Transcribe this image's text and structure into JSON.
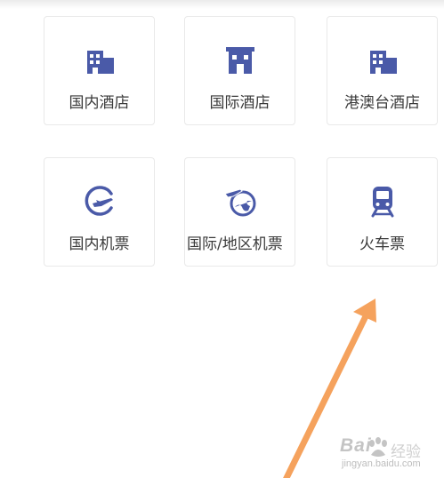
{
  "tiles": [
    {
      "label": "国内酒店",
      "icon": "hotel-building-icon"
    },
    {
      "label": "国际酒店",
      "icon": "hotel-storefront-icon"
    },
    {
      "label": "港澳台酒店",
      "icon": "hotel-building-icon"
    },
    {
      "label": "国内机票",
      "icon": "airplane-circle-icon"
    },
    {
      "label": "国际/地区机票",
      "icon": "airplane-globe-icon"
    },
    {
      "label": "火车票",
      "icon": "train-icon"
    }
  ],
  "watermark": {
    "logo": "Bai",
    "logo_tail": "经验",
    "url": "jingyan.baidu.com"
  },
  "colors": {
    "icon": "#4a5aa8",
    "label": "#3a3a3a",
    "tile_border": "#e9e9e9",
    "arrow": "#f5a25d"
  }
}
